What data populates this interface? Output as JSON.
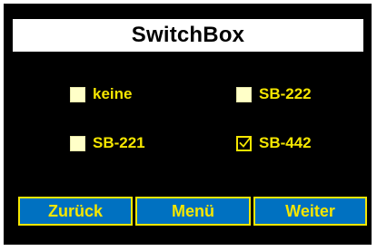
{
  "window": {
    "title": "SwitchBox"
  },
  "options": [
    {
      "label": "keine",
      "checked": false
    },
    {
      "label": "SB-222",
      "checked": false
    },
    {
      "label": "SB-221",
      "checked": false
    },
    {
      "label": "SB-442",
      "checked": true
    }
  ],
  "buttons": {
    "back_label": "Zurück",
    "menu_label": "Menü",
    "next_label": "Weiter"
  },
  "colors": {
    "background": "#000000",
    "accent_yellow": "#f5e600",
    "button_blue": "#0071c1",
    "checkbox_fill": "#ffffc8"
  },
  "icons": {
    "check": "check-icon"
  }
}
